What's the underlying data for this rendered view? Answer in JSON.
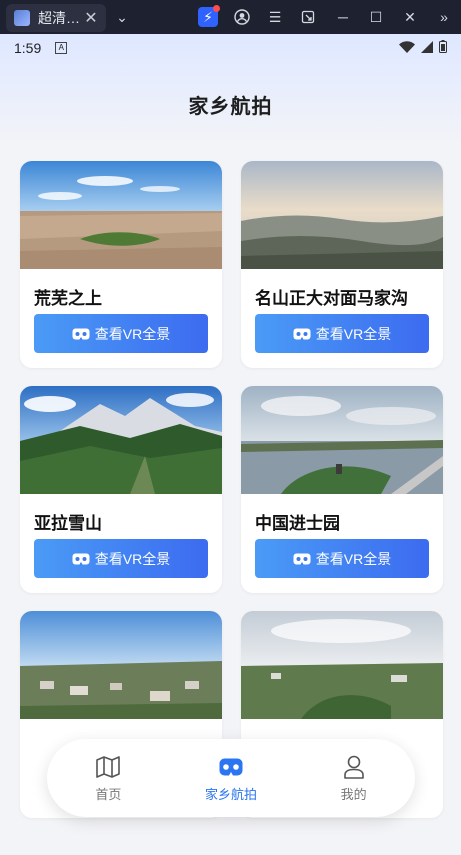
{
  "browser": {
    "tab_title": "超清…",
    "tab_close": "✕",
    "dropdown": "⌄"
  },
  "status_bar": {
    "time": "1:59",
    "app_badge": "A"
  },
  "header": {
    "title": "家乡航拍"
  },
  "cards": [
    {
      "name": "荒芜之上",
      "button": "查看VR全景",
      "scene": "desert"
    },
    {
      "name": "名山正大对面马家沟",
      "button": "查看VR全景",
      "scene": "haze"
    },
    {
      "name": "亚拉雪山",
      "button": "查看VR全景",
      "scene": "mountain"
    },
    {
      "name": "中国进士园",
      "button": "查看VR全景",
      "scene": "river"
    },
    {
      "name": "",
      "button": "",
      "scene": "town"
    },
    {
      "name": "",
      "button": "",
      "scene": "hills"
    }
  ],
  "nav": {
    "items": [
      {
        "label": "首页",
        "icon": "map-icon",
        "active": false
      },
      {
        "label": "家乡航拍",
        "icon": "vr-headset-icon",
        "active": true
      },
      {
        "label": "我的",
        "icon": "user-icon",
        "active": false
      }
    ]
  },
  "colors": {
    "accent": "#2b74f2",
    "button_gradient_start": "#4a9bf6",
    "button_gradient_end": "#3c6bf0"
  }
}
